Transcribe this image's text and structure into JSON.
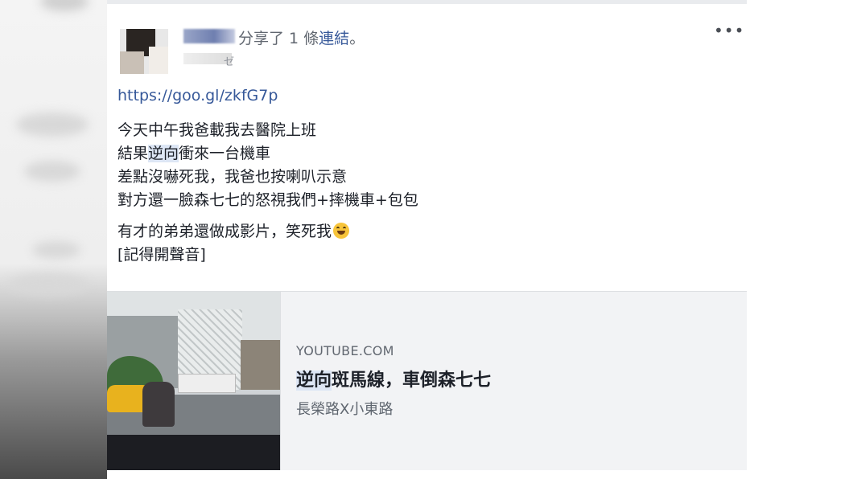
{
  "post": {
    "header_action": "分享了 1 條",
    "header_link": "連結",
    "header_end": "。",
    "sub_glyph": "ゼ",
    "more_label": "•••",
    "url": "https://goo.gl/zkfG7p",
    "lines": [
      "今天中午我爸載我去醫院上班",
      "結果",
      "逆向",
      "衝來一台機車",
      "差點沒嚇死我，我爸也按喇叭示意",
      "對方還一臉森七七的怒視我們+摔機車+包包",
      "有才的弟弟還做成影片，笑死我",
      "[記得開聲音]"
    ],
    "emoji": "grinning-squinting-face"
  },
  "preview": {
    "domain": "YOUTUBE.COM",
    "title_highlight": "逆向",
    "title_rest": "斑馬線，車倒森七七",
    "description": "長榮路X小東路"
  },
  "colors": {
    "link": "#365899",
    "text": "#1d2129",
    "muted": "#616770",
    "preview_bg": "#f2f3f5",
    "highlight": "#dde6f5"
  }
}
